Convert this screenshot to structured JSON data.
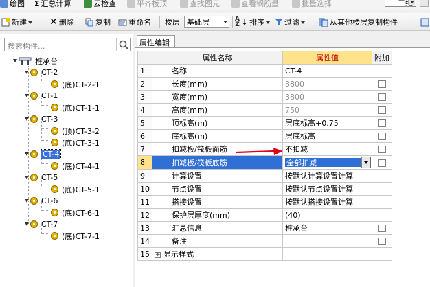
{
  "toolbar_top": {
    "items": [
      "绘图",
      "汇总计算",
      "云检查",
      "平齐板顶",
      "查找图元",
      "查看钢筋量",
      "批量选择"
    ],
    "view_combo": "二维",
    "colors": {
      "accent": "#3a6fd9",
      "header_value": "#ffe38a",
      "header_value_text": "#c00000",
      "arrow": "#e0001a"
    }
  },
  "toolbar_main": {
    "new": "新建",
    "delete": "删除",
    "copy": "复制",
    "rename": "重命名",
    "floor_label": "楼层",
    "floor_value": "基础层",
    "sort": "排序",
    "filter": "过滤",
    "copy_from_floor": "从其他楼层复制构件"
  },
  "search": {
    "placeholder": "搜索构件..."
  },
  "tree": {
    "root": "桩承台",
    "nodes": [
      {
        "label": "CT-2",
        "children": [
          "(底)CT-2-1"
        ]
      },
      {
        "label": "CT-1",
        "children": [
          "(底)CT-1-1"
        ]
      },
      {
        "label": "CT-3",
        "children": [
          "(顶)CT-3-2",
          "(底)CT-3-1"
        ]
      },
      {
        "label": "CT-4",
        "children": [
          "(底)CT-4-1"
        ],
        "selected": true
      },
      {
        "label": "CT-5",
        "children": [
          "(底)CT-5-1"
        ]
      },
      {
        "label": "CT-6",
        "children": [
          "(底)CT-6-1"
        ]
      },
      {
        "label": "CT-7",
        "children": [
          "(底)CT-7-1"
        ]
      }
    ]
  },
  "property_panel": {
    "tab": "属性编辑",
    "headers": {
      "name": "属性名称",
      "value": "属性值",
      "add": "附加"
    },
    "rows": [
      {
        "idx": "1",
        "name": "名称",
        "value": "CT-4"
      },
      {
        "idx": "2",
        "name": "长度(mm)",
        "value": "3800"
      },
      {
        "idx": "3",
        "name": "宽度(mm)",
        "value": "3800"
      },
      {
        "idx": "4",
        "name": "高度(mm)",
        "value": "750"
      },
      {
        "idx": "5",
        "name": "顶标高(m)",
        "value": "层底标高+0.75"
      },
      {
        "idx": "6",
        "name": "底标高(m)",
        "value": "层底标高"
      },
      {
        "idx": "7",
        "name": "扣减板/筏板面筋",
        "value": "不扣减"
      },
      {
        "idx": "8",
        "name": "扣减板/筏板底筋",
        "value": "全部扣减"
      },
      {
        "idx": "9",
        "name": "计算设置",
        "value": "按默认计算设置计算"
      },
      {
        "idx": "10",
        "name": "节点设置",
        "value": "按默认节点设置计算"
      },
      {
        "idx": "11",
        "name": "搭接设置",
        "value": "按默认搭接设置计算"
      },
      {
        "idx": "12",
        "name": "保护层厚度(mm)",
        "value": "(40)"
      },
      {
        "idx": "13",
        "name": "汇总信息",
        "value": "桩承台"
      },
      {
        "idx": "14",
        "name": "备注",
        "value": ""
      },
      {
        "idx": "15",
        "name": "显示样式",
        "value": ""
      }
    ]
  }
}
